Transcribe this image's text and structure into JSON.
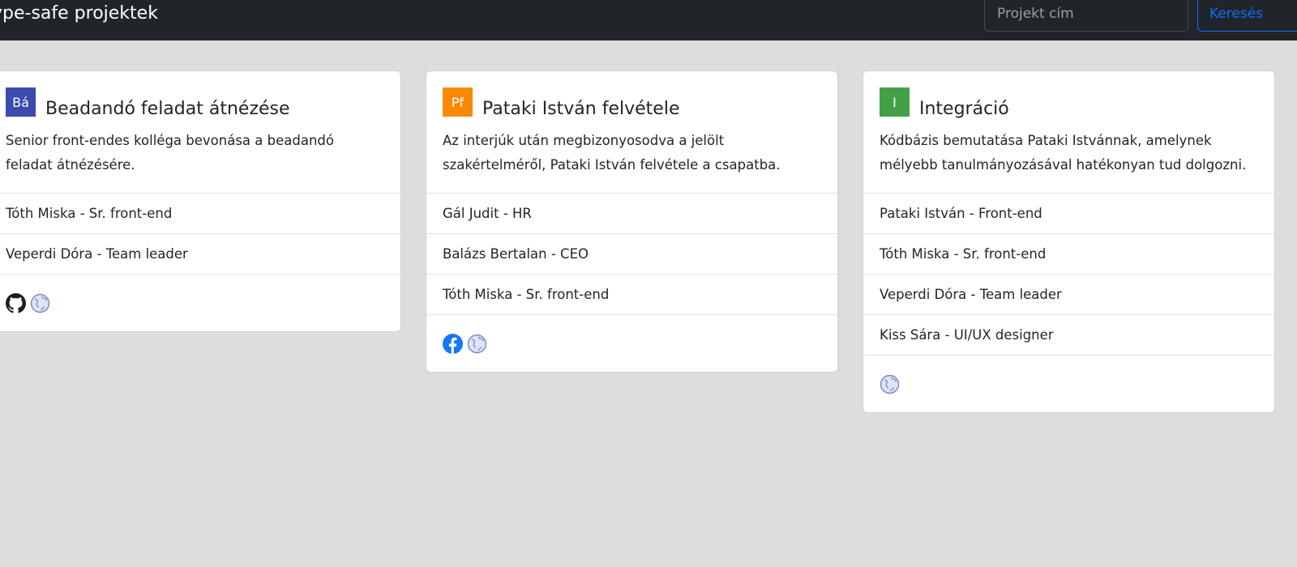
{
  "navbar": {
    "brand": "ype-safe projektek",
    "search_placeholder": "Projekt cím",
    "search_button": "Keresés"
  },
  "cards": [
    {
      "avatar_text": "Bá",
      "avatar_color": "#3b4aad",
      "title": "Beadandó feladat átnézése",
      "description": "Senior front-endes kolléga bevonása a beadandó feladat átnézésére.",
      "members": [
        "Tóth Miska - Sr. front-end",
        "Veperdi Dóra - Team leader"
      ],
      "links": [
        "github-icon",
        "globe-icon"
      ]
    },
    {
      "avatar_text": "Pf",
      "avatar_color": "#f98a00",
      "title": "Pataki István felvétele",
      "description": "Az interjúk után megbizonyosodva a jelölt szakértelméről, Pataki István felvétele a csapatba.",
      "members": [
        "Gál Judit - HR",
        "Balázs Bertalan - CEO",
        "Tóth Miska - Sr. front-end"
      ],
      "links": [
        "facebook-icon",
        "globe-icon"
      ]
    },
    {
      "avatar_text": "I",
      "avatar_color": "#43a047",
      "title": "Integráció",
      "description": "Kódbázis bemutatása Pataki Istvánnak, amelynek mélyebb tanulmányozásával hatékonyan tud dolgozni.",
      "members": [
        "Pataki István - Front-end",
        "Tóth Miska - Sr. front-end",
        "Veperdi Dóra - Team leader",
        "Kiss Sára - UI/UX designer"
      ],
      "links": [
        "globe-icon"
      ]
    }
  ]
}
